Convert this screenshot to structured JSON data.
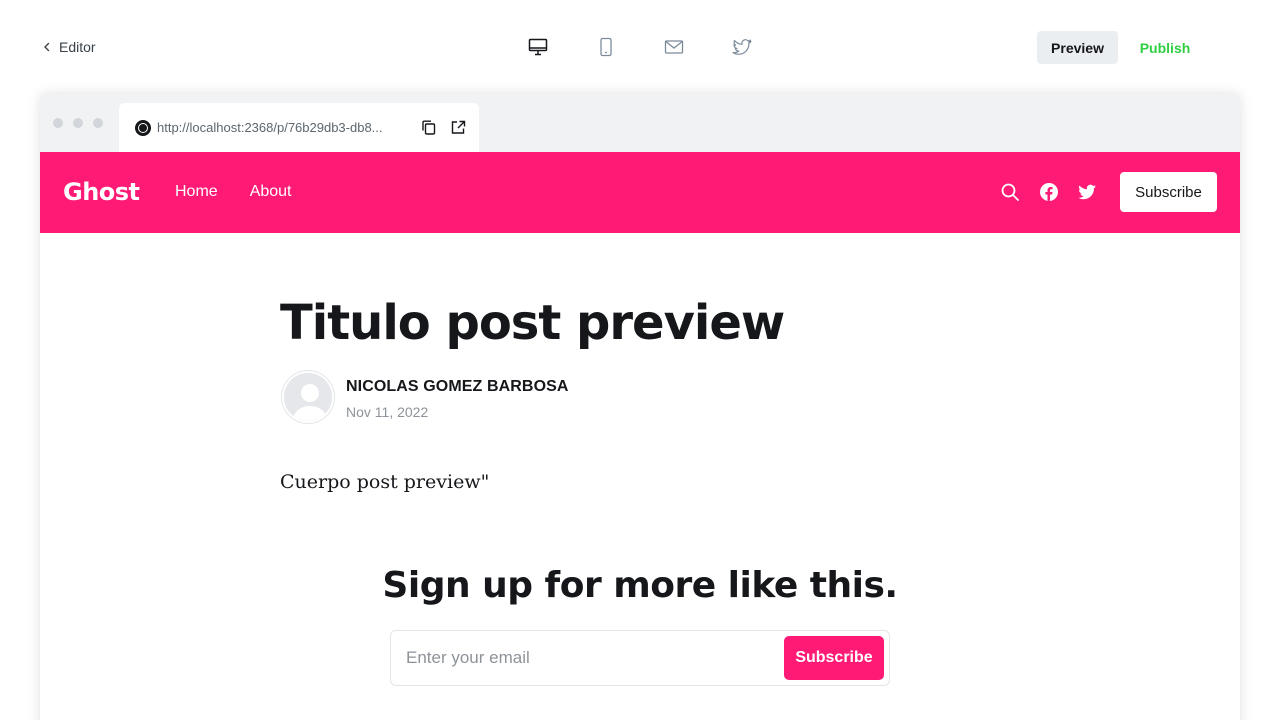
{
  "topbar": {
    "back_label": "Editor",
    "devices": [
      "desktop-icon",
      "mobile-icon",
      "email-icon",
      "twitter-icon"
    ],
    "preview_label": "Preview",
    "publish_label": "Publish"
  },
  "browser": {
    "url": "http://localhost:2368/p/76b29db3-db8..."
  },
  "site": {
    "logo": "Ghost",
    "nav": [
      "Home",
      "About"
    ],
    "subscribe_label": "Subscribe",
    "accent_color": "#ff1a75"
  },
  "post": {
    "title": "Titulo post preview",
    "author": "NICOLAS GOMEZ BARBOSA",
    "date": "Nov 11, 2022",
    "body": "Cuerpo post preview\""
  },
  "signup": {
    "heading": "Sign up for more like this.",
    "email_placeholder": "Enter your email",
    "subscribe_label": "Subscribe"
  }
}
